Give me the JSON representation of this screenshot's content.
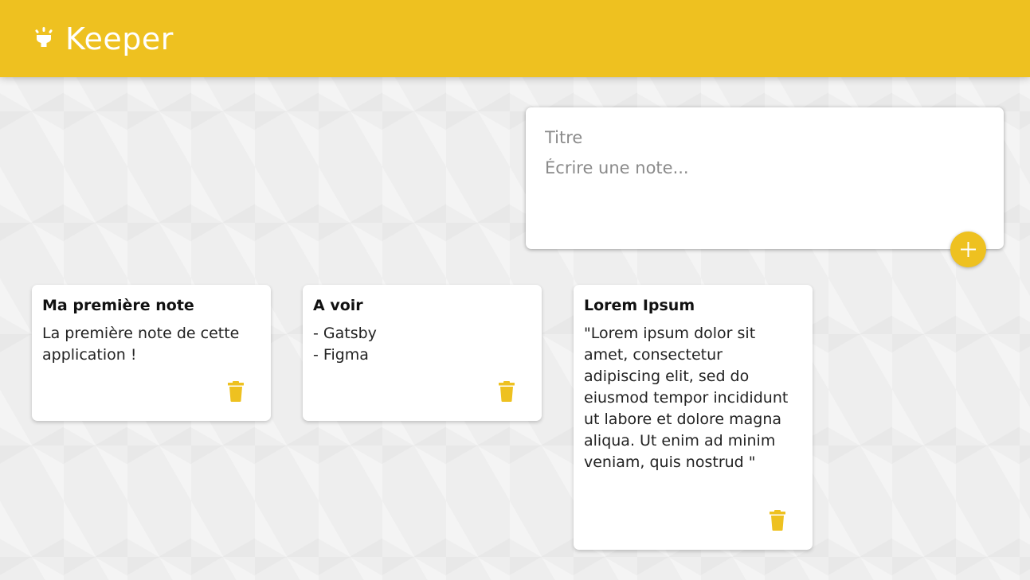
{
  "header": {
    "title": "Keeper",
    "icon": "lightbulb-icon"
  },
  "create_note": {
    "title_placeholder": "Titre",
    "content_placeholder": "Écrire une note...",
    "add_icon": "plus-icon"
  },
  "notes": [
    {
      "title": "Ma première note",
      "content": "La première note de cette application !",
      "delete_icon": "trash-icon"
    },
    {
      "title": "A voir",
      "content": "- Gatsby\n- Figma",
      "delete_icon": "trash-icon"
    },
    {
      "title": "Lorem Ipsum",
      "content": "\"Lorem ipsum dolor sit amet, consectetur adipiscing elit, sed do eiusmod tempor incididunt ut labore et dolore magna aliqua. Ut enim ad minim veniam, quis nostrud \"",
      "delete_icon": "trash-icon"
    }
  ],
  "colors": {
    "accent": "#eec120",
    "background": "#eeeeee",
    "card": "#ffffff"
  }
}
